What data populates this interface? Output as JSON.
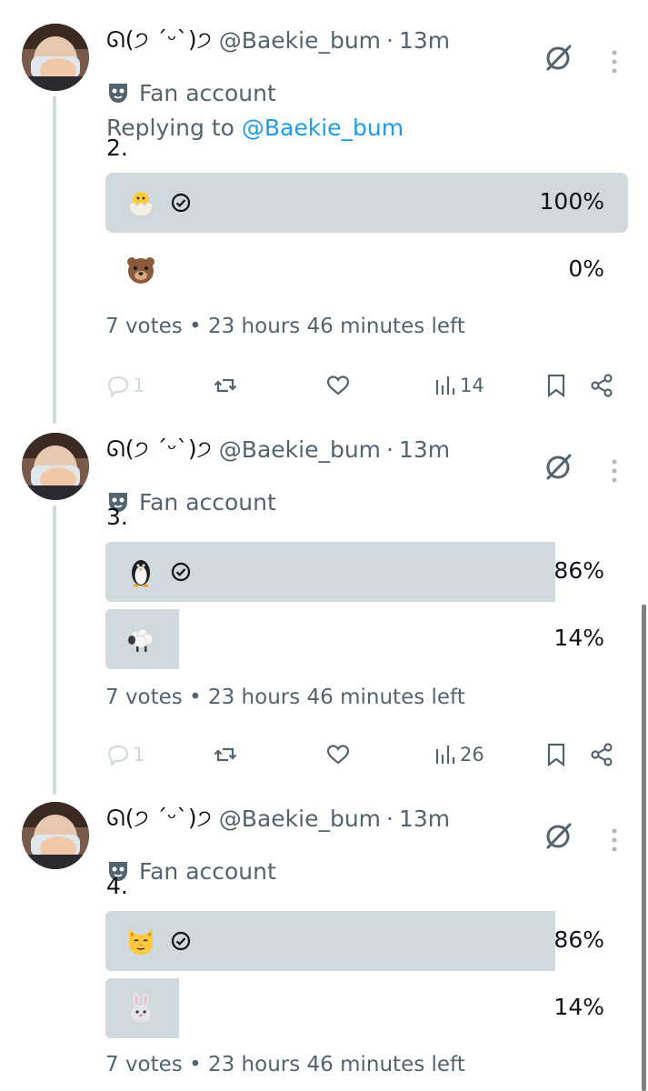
{
  "tweets": [
    {
      "display_name": "ᘏ(੭ ˊᵕˋ)੭",
      "handle": "@Baekie_bum",
      "separator": "·",
      "time": "13m",
      "label": "Fan account",
      "replying_prefix": "Replying to ",
      "replying_handle": "@Baekie_bum",
      "text": "2.",
      "poll": {
        "options": [
          {
            "emoji": "hatching-chick",
            "percent": "100%",
            "fraction": 1.0,
            "selected": true
          },
          {
            "emoji": "bear-face",
            "percent": "0%",
            "fraction": 0.0,
            "selected": false
          }
        ],
        "meta": "7 votes • 23 hours 46 minutes left"
      },
      "actions": {
        "replies": "1",
        "views": "14"
      }
    },
    {
      "display_name": "ᘏ(੭ ˊᵕˋ)੭",
      "handle": "@Baekie_bum",
      "separator": "·",
      "time": "13m",
      "label": "Fan account",
      "text": "3.",
      "poll": {
        "options": [
          {
            "emoji": "penguin",
            "percent": "86%",
            "fraction": 0.86,
            "selected": true
          },
          {
            "emoji": "sheep",
            "percent": "14%",
            "fraction": 0.14,
            "selected": false
          }
        ],
        "meta": "7 votes • 23 hours 46 minutes left"
      },
      "actions": {
        "replies": "1",
        "views": "26"
      }
    },
    {
      "display_name": "ᘏ(੭ ˊᵕˋ)੭",
      "handle": "@Baekie_bum",
      "separator": "·",
      "time": "13m",
      "label": "Fan account",
      "text": "4.",
      "poll": {
        "options": [
          {
            "emoji": "cat-face",
            "percent": "86%",
            "fraction": 0.86,
            "selected": true
          },
          {
            "emoji": "rabbit-face",
            "percent": "14%",
            "fraction": 0.14,
            "selected": false
          }
        ],
        "meta": "7 votes • 23 hours 46 minutes left"
      }
    }
  ],
  "colors": {
    "text": "#0f1419",
    "secondary": "#536471",
    "link": "#1d9bf0",
    "poll_fill": "#cfd9de",
    "thread_line": "#cfd9de"
  }
}
